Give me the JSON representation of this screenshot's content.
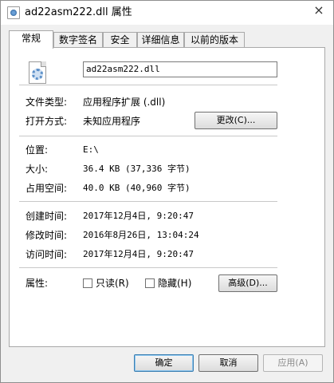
{
  "window": {
    "title": "ad22asm222.dll 属性",
    "close_glyph": "×"
  },
  "tabs": [
    {
      "label": "常规",
      "active": true
    },
    {
      "label": "数字签名"
    },
    {
      "label": "安全"
    },
    {
      "label": "详细信息"
    },
    {
      "label": "以前的版本"
    }
  ],
  "file": {
    "name": "ad22asm222.dll",
    "icon": "dll-file-gear-icon"
  },
  "info": {
    "type_label": "文件类型:",
    "type_value": "应用程序扩展 (.dll)",
    "opens_label": "打开方式:",
    "opens_value": "未知应用程序",
    "change_button": "更改(C)...",
    "location_label": "位置:",
    "location_value": "E:\\",
    "size_label": "大小:",
    "size_value": "36.4 KB (37,336 字节)",
    "disk_label": "占用空间:",
    "disk_value": "40.0 KB (40,960 字节)",
    "created_label": "创建时间:",
    "created_value": "2017年12月4日, 9:20:47",
    "modified_label": "修改时间:",
    "modified_value": "2016年8月26日, 13:04:24",
    "accessed_label": "访问时间:",
    "accessed_value": "2017年12月4日, 9:20:47",
    "attributes_label": "属性:",
    "readonly_label": "只读(R)",
    "hidden_label": "隐藏(H)",
    "advanced_button": "高级(D)..."
  },
  "footer": {
    "ok": "确定",
    "cancel": "取消",
    "apply": "应用(A)"
  }
}
